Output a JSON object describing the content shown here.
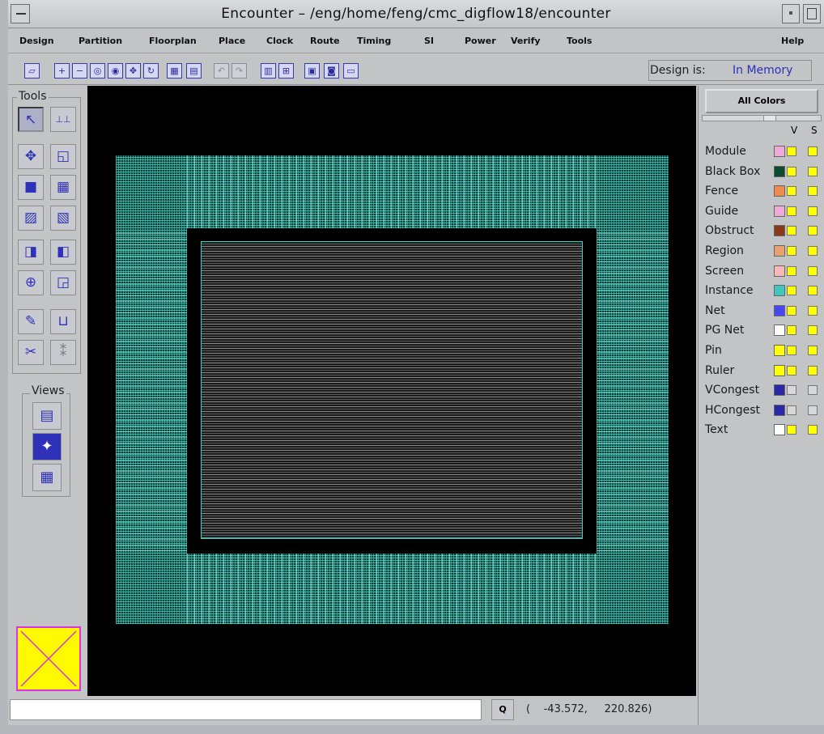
{
  "window": {
    "title": "Encounter – /eng/home/feng/cmc_digflow18/encounter"
  },
  "menu": [
    {
      "label": "Design"
    },
    {
      "label": "Partition"
    },
    {
      "label": "Floorplan"
    },
    {
      "label": "Place"
    },
    {
      "label": "Clock"
    },
    {
      "label": "Route"
    },
    {
      "label": "Timing"
    },
    {
      "label": "SI"
    },
    {
      "label": "Power"
    },
    {
      "label": "Verify"
    },
    {
      "label": "Tools"
    },
    {
      "label": "Help"
    }
  ],
  "toolbar": {
    "design_is_label": "Design is:",
    "design_is_value": "In Memory",
    "icons": [
      "open-icon",
      "zoom-in-icon",
      "zoom-out-icon",
      "zoom-fit-icon",
      "zoom-selected-icon",
      "pan-icon",
      "redraw-icon",
      "floorplan-view-icon",
      "layout-view-icon",
      "undo-icon",
      "redo-icon",
      "hierarchy-icon",
      "net-icon",
      "save-icon",
      "screenshot-icon",
      "terminal-icon"
    ]
  },
  "tools": {
    "label": "Tools",
    "buttons": [
      "select-icon",
      "ruler-icon",
      "move-icon",
      "resize-icon",
      "block-icon",
      "grid-icon",
      "partition-icon",
      "region-icon",
      "fence-icon",
      "guide-icon",
      "cut-row-icon",
      "snap-icon",
      "wire-edit-icon",
      "ruler-measure-icon",
      "scissors-icon",
      "bus-icon"
    ]
  },
  "views": {
    "label": "Views",
    "buttons": [
      "floorplan-view-icon",
      "amoeba-view-icon",
      "physical-view-icon"
    ]
  },
  "right_panel": {
    "all_colors_label": "All Colors",
    "col_v": "V",
    "col_s": "S",
    "legend": [
      {
        "label": "Module",
        "color": "#f0a8d8",
        "v": "#ffff00",
        "s": "#ffff00"
      },
      {
        "label": "Black Box",
        "color": "#0e4a30",
        "v": "#ffff00",
        "s": "#ffff00"
      },
      {
        "label": "Fence",
        "color": "#f08a50",
        "v": "#ffff00",
        "s": "#ffff00"
      },
      {
        "label": "Guide",
        "color": "#f0a8d8",
        "v": "#ffff00",
        "s": "#ffff00"
      },
      {
        "label": "Obstruct",
        "color": "#8a3a1a",
        "v": "#ffff00",
        "s": "#ffff00"
      },
      {
        "label": "Region",
        "color": "#e8a070",
        "v": "#ffff00",
        "s": "#ffff00"
      },
      {
        "label": "Screen",
        "color": "#f8b8b8",
        "v": "#ffff00",
        "s": "#ffff00"
      },
      {
        "label": "Instance",
        "color": "#40c8c0",
        "v": "#ffff00",
        "s": "#ffff00"
      },
      {
        "label": "Net",
        "color": "#4848f0",
        "v": "#ffff00",
        "s": "#ffff00"
      },
      {
        "label": "PG Net",
        "color": "#ffffff",
        "v": "#ffff00",
        "s": "#ffff00"
      },
      {
        "label": "Pin",
        "color": "#ffff00",
        "v": "#ffff00",
        "s": "#ffff00"
      },
      {
        "label": "Ruler",
        "color": "#ffff00",
        "v": "#ffff00",
        "s": "#ffff00"
      },
      {
        "label": "VCongest",
        "color": "#2828a8",
        "v": "#d8d8d8",
        "s": "#d8d8d8"
      },
      {
        "label": "HCongest",
        "color": "#2828a8",
        "v": "#d8d8d8",
        "s": "#d8d8d8"
      },
      {
        "label": "Text",
        "color": "#ffffff",
        "v": "#ffff00",
        "s": "#ffff00"
      }
    ]
  },
  "status": {
    "command_value": "",
    "button_label": "Q",
    "coords": "(    -43.572,     220.826)"
  }
}
